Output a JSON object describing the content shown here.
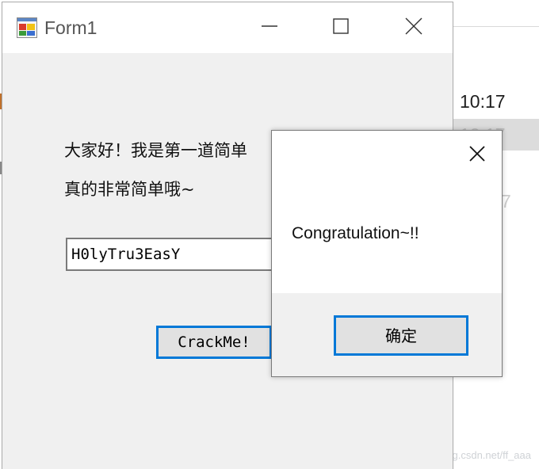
{
  "background_window": {
    "row1_time": "10:17",
    "row2_time": "10:17",
    "row3_time": "7",
    "watermark": "https://blog.csdn.net/ff_aaa"
  },
  "form1": {
    "title": "Form1",
    "icon": "winforms-app-icon",
    "message_line1": "大家好！我是第一道简单",
    "message_line2": "真的非常简单哦~",
    "input_value": "H0lyTru3EasY",
    "crack_button_label": "CrackMe!",
    "caption_buttons": [
      "minimize-icon",
      "maximize-icon",
      "close-icon"
    ]
  },
  "message_box": {
    "text": "Congratulation~!!",
    "ok_label": "确定",
    "close_icon": "close-icon"
  },
  "colors": {
    "accent": "#0078d7",
    "form_background": "#f0f0f0",
    "titlebar": "#ffffff"
  }
}
